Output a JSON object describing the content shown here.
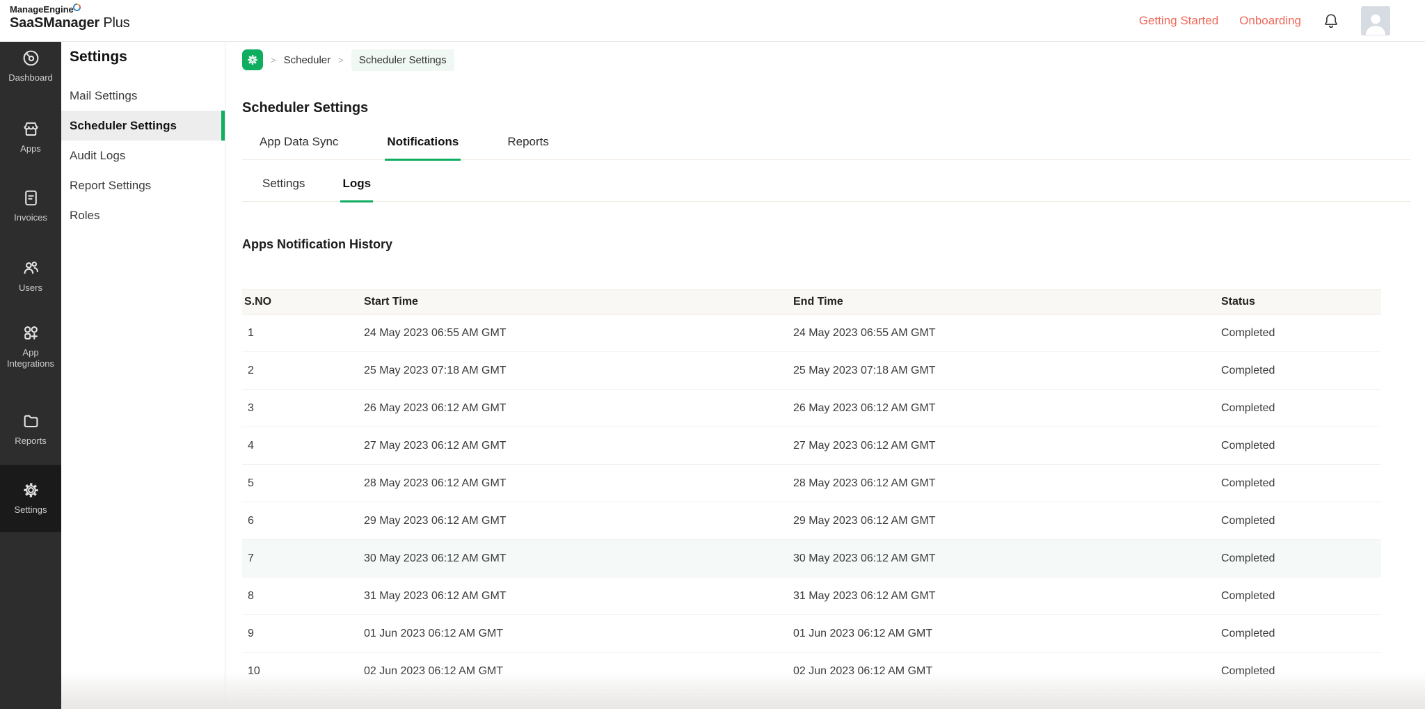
{
  "brand": {
    "company": "ManageEngine",
    "product_bold": "SaaSManager",
    "product_regular": "Plus"
  },
  "topbar": {
    "links": [
      {
        "label": "Getting Started"
      },
      {
        "label": "Onboarding"
      }
    ]
  },
  "sidebar": {
    "items": [
      {
        "label": "Dashboard",
        "icon": "dashboard-icon"
      },
      {
        "label": "Apps",
        "icon": "apps-storefront-icon"
      },
      {
        "label": "Invoices",
        "icon": "invoices-document-icon"
      },
      {
        "label": "Users",
        "icon": "users-icon"
      },
      {
        "label": "App Integrations",
        "icon": "app-integrations-icon"
      },
      {
        "label": "Reports",
        "icon": "reports-folder-icon"
      },
      {
        "label": "Settings",
        "icon": "settings-gear-icon",
        "active": true
      }
    ]
  },
  "settings_menu": {
    "title": "Settings",
    "items": [
      {
        "label": "Mail Settings"
      },
      {
        "label": "Scheduler Settings",
        "active": true
      },
      {
        "label": "Audit Logs"
      },
      {
        "label": "Report Settings"
      },
      {
        "label": "Roles"
      }
    ]
  },
  "breadcrumb": {
    "separator": ">",
    "items": [
      {
        "label": "Scheduler"
      },
      {
        "label": "Scheduler Settings"
      }
    ]
  },
  "page": {
    "title": "Scheduler Settings",
    "tabs": [
      {
        "label": "App Data Sync"
      },
      {
        "label": "Notifications",
        "active": true
      },
      {
        "label": "Reports"
      }
    ],
    "subtabs": [
      {
        "label": "Settings"
      },
      {
        "label": "Logs",
        "active": true
      }
    ],
    "section_title": "Apps Notification History"
  },
  "table": {
    "columns": [
      "S.NO",
      "Start Time",
      "End Time",
      "Status"
    ],
    "rows": [
      {
        "sno": "1",
        "start": "24 May 2023 06:55 AM GMT",
        "end": "24 May 2023 06:55 AM GMT",
        "status": "Completed"
      },
      {
        "sno": "2",
        "start": "25 May 2023 07:18 AM GMT",
        "end": "25 May 2023 07:18 AM GMT",
        "status": "Completed"
      },
      {
        "sno": "3",
        "start": "26 May 2023 06:12 AM GMT",
        "end": "26 May 2023 06:12 AM GMT",
        "status": "Completed"
      },
      {
        "sno": "4",
        "start": "27 May 2023 06:12 AM GMT",
        "end": "27 May 2023 06:12 AM GMT",
        "status": "Completed"
      },
      {
        "sno": "5",
        "start": "28 May 2023 06:12 AM GMT",
        "end": "28 May 2023 06:12 AM GMT",
        "status": "Completed"
      },
      {
        "sno": "6",
        "start": "29 May 2023 06:12 AM GMT",
        "end": "29 May 2023 06:12 AM GMT",
        "status": "Completed"
      },
      {
        "sno": "7",
        "start": "30 May 2023 06:12 AM GMT",
        "end": "30 May 2023 06:12 AM GMT",
        "status": "Completed"
      },
      {
        "sno": "8",
        "start": "31 May 2023 06:12 AM GMT",
        "end": "31 May 2023 06:12 AM GMT",
        "status": "Completed"
      },
      {
        "sno": "9",
        "start": "01 Jun 2023 06:12 AM GMT",
        "end": "01 Jun 2023 06:12 AM GMT",
        "status": "Completed"
      },
      {
        "sno": "10",
        "start": "02 Jun 2023 06:12 AM GMT",
        "end": "02 Jun 2023 06:12 AM GMT",
        "status": "Completed"
      }
    ]
  },
  "colors": {
    "accent_green": "#0EAD60",
    "accent_orange": "#F0695A"
  }
}
